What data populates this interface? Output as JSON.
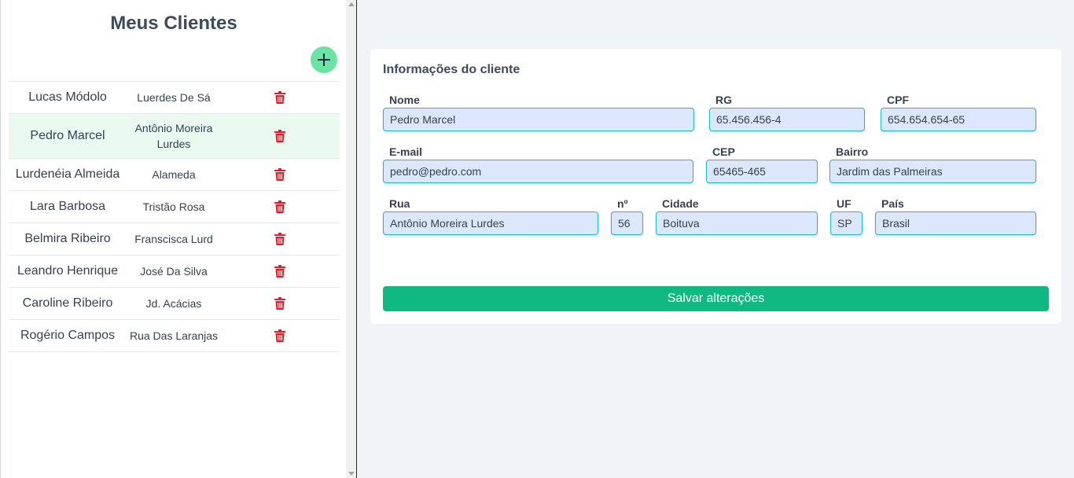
{
  "sidebar": {
    "title": "Meus Clientes",
    "clients": [
      {
        "name": "Lucas Módolo",
        "street": "Luerdes De Sá"
      },
      {
        "name": "Pedro Marcel",
        "street": "Antônio Moreira Lurdes"
      },
      {
        "name": "Lurdenéia Almeida",
        "street": "Alameda"
      },
      {
        "name": "Lara Barbosa",
        "street": "Tristão Rosa"
      },
      {
        "name": "Belmira Ribeiro",
        "street": "Franscisca Lurd"
      },
      {
        "name": "Leandro Henrique",
        "street": "José Da Silva"
      },
      {
        "name": "Caroline Ribeiro",
        "street": "Jd. Acácias"
      },
      {
        "name": "Rogério Campos",
        "street": "Rua Das Laranjas"
      }
    ],
    "selected_index": 1,
    "add_icon": "plus-icon",
    "delete_icon": "trash-icon"
  },
  "form": {
    "title": "Informações do cliente",
    "fields": {
      "nome": {
        "label": "Nome",
        "value": "Pedro Marcel"
      },
      "rg": {
        "label": "RG",
        "value": "65.456.456-4"
      },
      "cpf": {
        "label": "CPF",
        "value": "654.654.654-65"
      },
      "email": {
        "label": "E-mail",
        "value": "pedro@pedro.com"
      },
      "cep": {
        "label": "CEP",
        "value": "65465-465"
      },
      "bairro": {
        "label": "Bairro",
        "value": "Jardim das Palmeiras"
      },
      "rua": {
        "label": "Rua",
        "value": "Antônio Moreira Lurdes"
      },
      "numero": {
        "label": "nº",
        "value": "56"
      },
      "cidade": {
        "label": "Cidade",
        "value": "Boituva"
      },
      "uf": {
        "label": "UF",
        "value": "SP"
      },
      "pais": {
        "label": "País",
        "value": "Brasil"
      }
    },
    "save_label": "Salvar alterações"
  },
  "colors": {
    "accent_green": "#10b981",
    "add_button": "#6be3a4",
    "delete_red": "#e11d2a",
    "input_bg": "#dbe7fb",
    "input_border": "#1fb8c9",
    "selected_row": "#eafaf1"
  }
}
